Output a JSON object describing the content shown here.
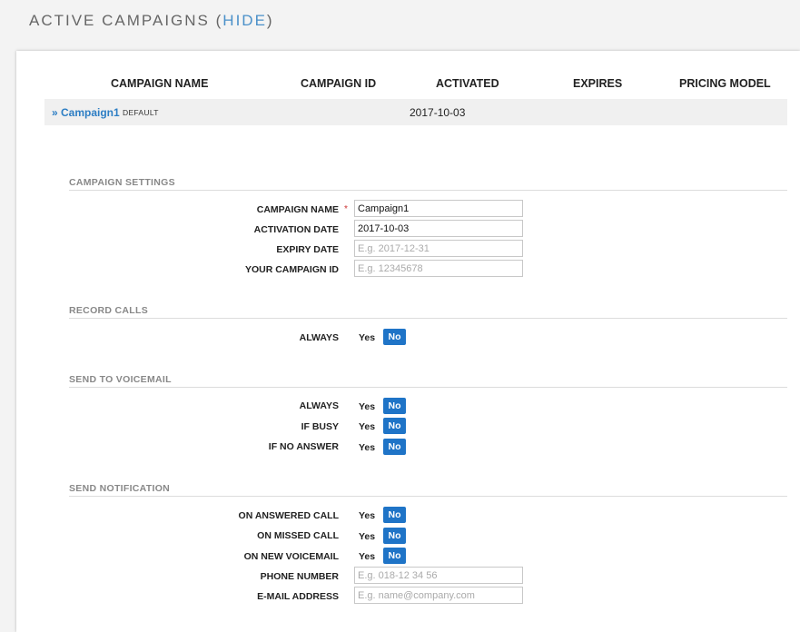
{
  "header": {
    "title": "ACTIVE CAMPAIGNS",
    "paren_open": "(",
    "hide_link": "HIDE",
    "paren_close": ")"
  },
  "table": {
    "columns": [
      "CAMPAIGN NAME",
      "CAMPAIGN ID",
      "ACTIVATED",
      "EXPIRES",
      "PRICING MODEL"
    ],
    "row": {
      "name": "» Campaign1",
      "badge": "DEFAULT",
      "campaign_id": "",
      "activated": "2017-10-03",
      "expires": "",
      "pricing_model": ""
    }
  },
  "settings": {
    "title": "CAMPAIGN SETTINGS",
    "campaign_name_label": "CAMPAIGN NAME",
    "required_marker": "*",
    "campaign_name_value": "Campaign1",
    "activation_date_label": "ACTIVATION DATE",
    "activation_date_value": "2017-10-03",
    "expiry_date_label": "EXPIRY DATE",
    "expiry_date_placeholder": "E.g. 2017-12-31",
    "your_campaign_id_label": "YOUR CAMPAIGN ID",
    "your_campaign_id_placeholder": "E.g. 12345678"
  },
  "record_calls": {
    "title": "RECORD CALLS",
    "always_label": "ALWAYS",
    "yes": "Yes",
    "no": "No",
    "selected": "No"
  },
  "voicemail": {
    "title": "SEND TO VOICEMAIL",
    "always_label": "ALWAYS",
    "if_busy_label": "IF BUSY",
    "if_no_answer_label": "IF NO ANSWER",
    "yes": "Yes",
    "no": "No"
  },
  "notification": {
    "title": "SEND NOTIFICATION",
    "on_answered_label": "ON ANSWERED CALL",
    "on_missed_label": "ON MISSED CALL",
    "on_new_voicemail_label": "ON NEW VOICEMAIL",
    "phone_label": "PHONE NUMBER",
    "phone_placeholder": "E.g. 018-12 34 56",
    "email_label": "E-MAIL ADDRESS",
    "email_placeholder": "E.g. name@company.com",
    "yes": "Yes",
    "no": "No"
  },
  "colors": {
    "accent": "#1f74c7",
    "link": "#2d7ec4",
    "background": "#f3f3f3"
  }
}
